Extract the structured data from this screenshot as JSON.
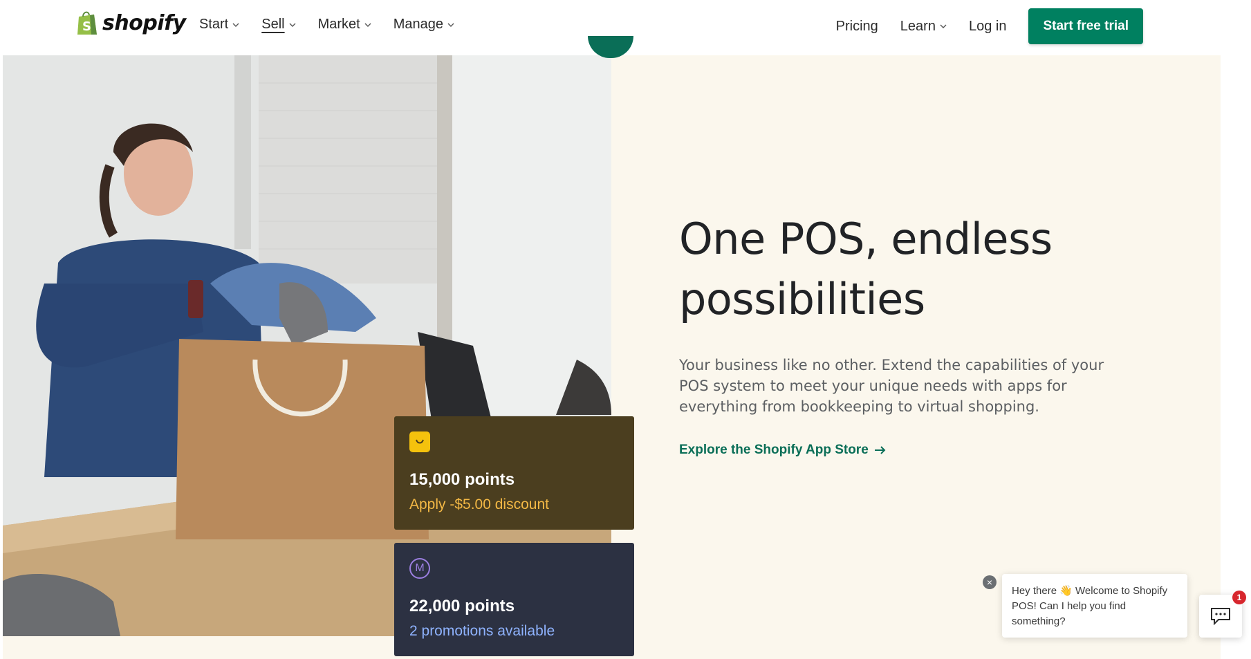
{
  "header": {
    "logo_text": "shopify",
    "nav_left": [
      {
        "label": "Start",
        "has_dropdown": true
      },
      {
        "label": "Sell",
        "has_dropdown": true,
        "active": true
      },
      {
        "label": "Market",
        "has_dropdown": true
      },
      {
        "label": "Manage",
        "has_dropdown": true
      }
    ],
    "nav_right": {
      "pricing": "Pricing",
      "learn": "Learn",
      "login": "Log in",
      "cta": "Start free trial"
    }
  },
  "hero": {
    "headline": "One POS, endless possibilities",
    "subcopy": "Your business like no other. Extend the capabilities of your POS system to meet your unique needs with apps for everything from bookkeeping to virtual shopping.",
    "link": "Explore the Shopify App Store",
    "link_icon": "arrow-right-icon",
    "image_description": "photo"
  },
  "cards": [
    {
      "icon": "smile-app-icon",
      "points": "15,000 points",
      "subtitle": "Apply -$5.00 discount",
      "bg": "#4b3e1f",
      "accent": "#f3b845"
    },
    {
      "icon": "m-circle-icon",
      "icon_text": "M",
      "points": "22,000 points",
      "subtitle": "2 promotions available",
      "bg": "#2c3142",
      "accent": "#8fb3ff"
    }
  ],
  "chat": {
    "message": "Hey there 👋 Welcome to Shopify POS! Can I help you find something?",
    "badge_count": "1",
    "close": "×"
  },
  "colors": {
    "brand_green": "#008060",
    "link_green": "#0a6e57",
    "panel_bg": "#fbf7ed"
  }
}
